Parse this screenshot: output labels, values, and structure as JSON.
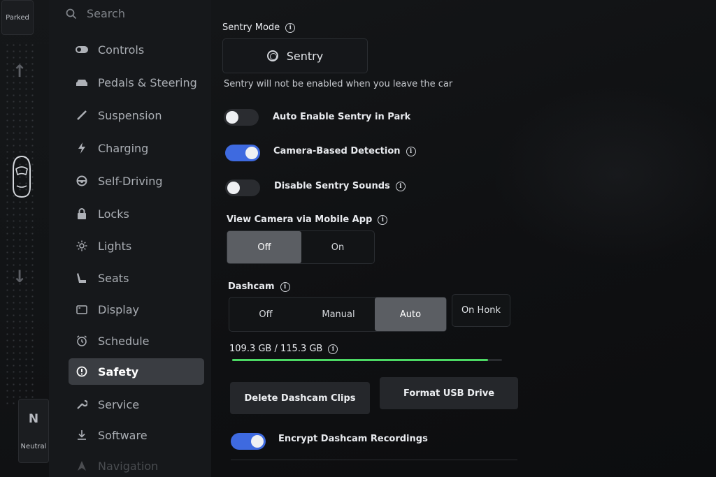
{
  "gear": {
    "top_label": "Parked",
    "current_gear": "N",
    "current_label": "Neutral"
  },
  "sidebar": {
    "search_label": "Search",
    "items": [
      {
        "label": "Controls",
        "icon": "toggle-icon"
      },
      {
        "label": "Pedals & Steering",
        "icon": "car-icon"
      },
      {
        "label": "Suspension",
        "icon": "suspension-icon"
      },
      {
        "label": "Charging",
        "icon": "bolt-icon"
      },
      {
        "label": "Self-Driving",
        "icon": "steering-wheel-icon"
      },
      {
        "label": "Locks",
        "icon": "lock-icon"
      },
      {
        "label": "Lights",
        "icon": "sun-icon"
      },
      {
        "label": "Seats",
        "icon": "seat-icon"
      },
      {
        "label": "Display",
        "icon": "display-icon"
      },
      {
        "label": "Schedule",
        "icon": "alarm-clock-icon"
      },
      {
        "label": "Safety",
        "icon": "alert-circle-icon",
        "active": true
      },
      {
        "label": "Service",
        "icon": "wrench-icon"
      },
      {
        "label": "Software",
        "icon": "download-icon"
      },
      {
        "label": "Navigation",
        "icon": "navigation-icon"
      }
    ]
  },
  "sentry": {
    "title": "Sentry Mode",
    "button_label": "Sentry",
    "note": "Sentry will not be enabled when you leave the car"
  },
  "toggles": {
    "auto_enable": {
      "label": "Auto Enable Sentry in Park",
      "on": false
    },
    "camera_detection": {
      "label": "Camera-Based Detection",
      "on": true
    },
    "disable_sounds": {
      "label": "Disable Sentry Sounds",
      "on": false
    },
    "encrypt": {
      "label": "Encrypt Dashcam Recordings",
      "on": true
    }
  },
  "view_camera": {
    "title": "View Camera via Mobile App",
    "options": [
      "Off",
      "On"
    ],
    "selected": "Off"
  },
  "dashcam": {
    "title": "Dashcam",
    "options": [
      "Off",
      "Manual",
      "Auto"
    ],
    "selected": "Auto",
    "extra_option": "On Honk"
  },
  "storage": {
    "used": "109.3 GB",
    "separator": " / ",
    "total": "115.3 GB",
    "used_fraction": 0.948
  },
  "actions": {
    "delete_clips": "Delete Dashcam Clips",
    "format_usb": "Format USB Drive"
  },
  "colors": {
    "accent": "#3e6ae0",
    "storage_bar": "#4cd964",
    "active_nav": "#3a3d42"
  }
}
